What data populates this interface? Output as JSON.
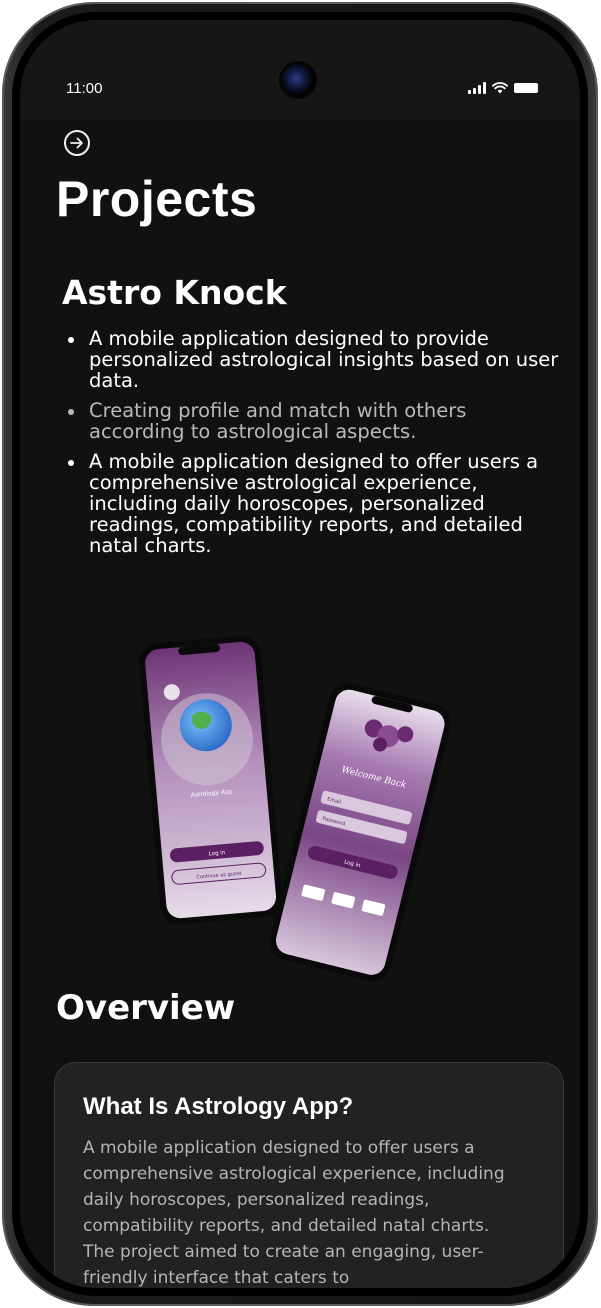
{
  "status_bar": {
    "time": "11:00"
  },
  "header": {
    "title": "Projects"
  },
  "project": {
    "name": "Astro Knock",
    "bullets": [
      "A mobile application designed to provide personalized astrological insights based on user data.",
      "Creating profile and match with others according to astrological aspects.",
      "A mobile application designed to offer users a comprehensive astrological experience, including daily horoscopes, personalized readings, compatibility reports, and detailed natal charts."
    ]
  },
  "mockup": {
    "left_phone": {
      "app_title": "Astrology App",
      "login_button": "Log in",
      "guest_button": "Continue as guest"
    },
    "right_phone": {
      "heading": "Welcome Back",
      "email_placeholder": "Email",
      "password_placeholder": "Password",
      "login_button": "Log in"
    }
  },
  "overview": {
    "heading": "Overview",
    "card_title": "What Is Astrology App?",
    "card_text": "A mobile application designed to offer users a comprehensive astrological experience, including daily horoscopes, personalized readings, compatibility reports, and detailed natal charts. The project aimed to create an engaging, user-friendly interface that caters to"
  },
  "icons": {
    "back": "arrow-right-circle-icon",
    "signal": "cellular-signal-icon",
    "wifi": "wifi-icon",
    "battery": "battery-icon"
  },
  "colors": {
    "screen_bg": "#111111",
    "card_bg": "#222222",
    "accent_purple": "#6b2a72",
    "muted_text": "#b9b9b9"
  }
}
